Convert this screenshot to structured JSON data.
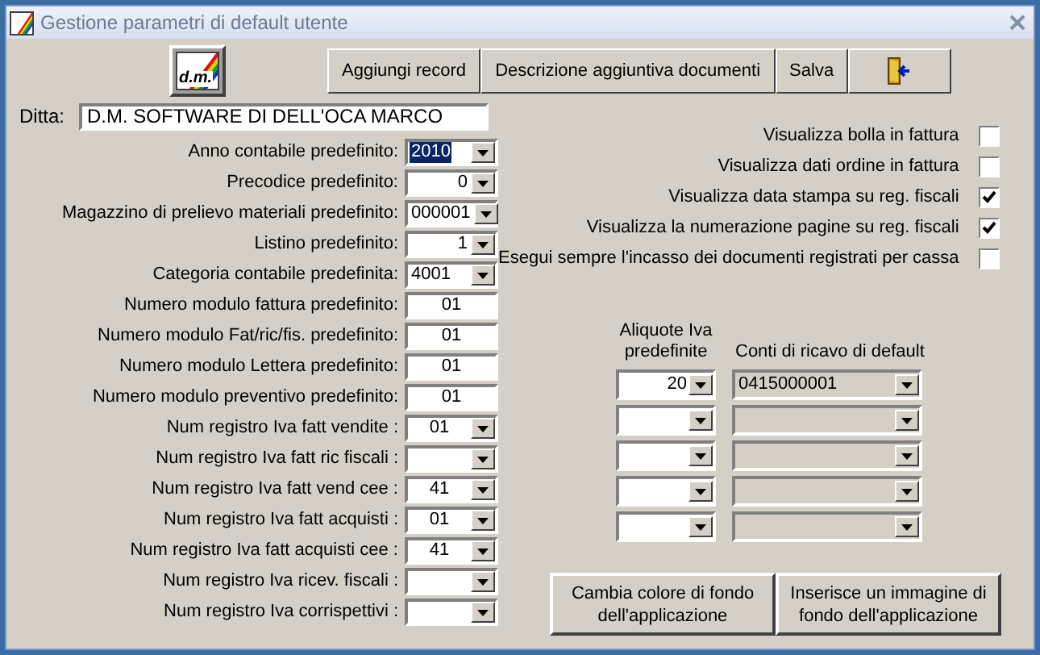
{
  "window": {
    "title": "Gestione parametri di default utente"
  },
  "toolbar": {
    "logo": "d.m.",
    "buttons": [
      {
        "kind": "text",
        "label": "Aggiungi record"
      },
      {
        "kind": "text",
        "label": "Descrizione aggiuntiva documenti"
      },
      {
        "kind": "text",
        "label": "Salva"
      },
      {
        "kind": "exit"
      }
    ]
  },
  "ditta": {
    "label": "Ditta:",
    "value": "D.M. SOFTWARE DI DELL'OCA MARCO"
  },
  "fields": [
    {
      "label": "Anno contabile predefinito:",
      "kind": "code",
      "value": "2010",
      "highlighted": true
    },
    {
      "label": "Precodice predefinito:",
      "kind": "number",
      "value": "0"
    },
    {
      "label": "Magazzino di prelievo materiali predefinito:",
      "kind": "code",
      "value": "000001"
    },
    {
      "label": "Listino predefinito:",
      "kind": "number",
      "value": "1"
    },
    {
      "label": "Categoria contabile predefinita:",
      "kind": "code",
      "value": "4001"
    },
    {
      "label": "Numero modulo fattura predefinito:",
      "kind": "text",
      "value": "01"
    },
    {
      "label": "Numero modulo Fat/ric/fis. predefinito:",
      "kind": "text",
      "value": "01"
    },
    {
      "label": "Numero modulo Lettera predefinito:",
      "kind": "text",
      "value": "01"
    },
    {
      "label": "Numero modulo preventivo predefinito:",
      "kind": "text",
      "value": "01"
    },
    {
      "label": "Num registro Iva fatt vendite :",
      "kind": "register",
      "value": "01"
    },
    {
      "label": "Num registro Iva fatt ric fiscali :",
      "kind": "register"
    },
    {
      "label": "Num registro Iva fatt vend cee :",
      "kind": "register",
      "value": "41"
    },
    {
      "label": "Num registro Iva fatt acquisti :",
      "kind": "register",
      "value": "01"
    },
    {
      "label": "Num registro Iva fatt acquisti cee :",
      "kind": "register",
      "value": "41"
    },
    {
      "label": "Num registro Iva ricev. fiscali :",
      "kind": "register"
    },
    {
      "label": "Num registro Iva corrispettivi :",
      "kind": "register"
    }
  ],
  "options": [
    {
      "label": "Visualizza bolla in fattura",
      "checked": false
    },
    {
      "label": "Visualizza dati ordine in fattura",
      "checked": false
    },
    {
      "label": "Visualizza data stampa su reg. fiscali",
      "checked": true
    },
    {
      "label": "Visualizza la numerazione pagine su reg. fiscali",
      "checked": true
    },
    {
      "label": "Esegui sempre l'incasso dei documenti registrati per cassa",
      "checked": false
    }
  ],
  "iva_table": {
    "columns": [
      "Aliquote Iva predefinite",
      "Conti di ricavo di default"
    ],
    "rows": [
      {
        "aliquota": "20",
        "conto": "0415000001"
      },
      {},
      {},
      {},
      {}
    ]
  },
  "bottom_buttons": [
    "Cambia colore di fondo dell'applicazione",
    "Inserisce un immagine di fondo dell'applicazione"
  ]
}
